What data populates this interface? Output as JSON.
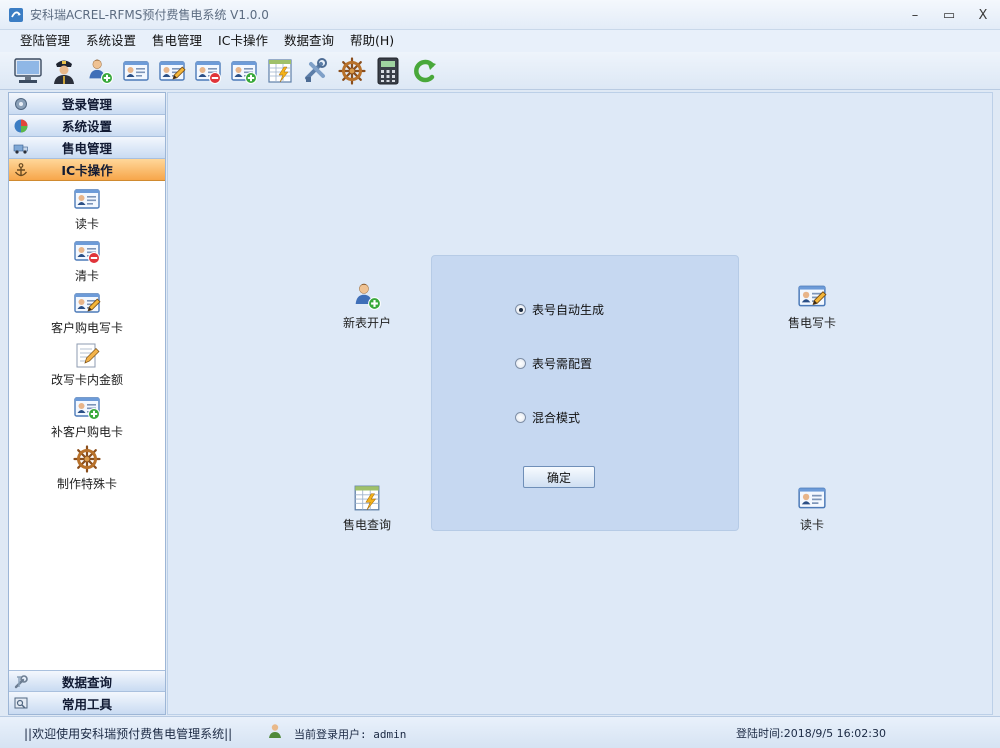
{
  "window": {
    "title": "安科瑞ACREL-RFMS预付费售电系统 V1.0.0",
    "minimize": "–",
    "maximize": "▭",
    "close": "X"
  },
  "menu": [
    "登陆管理",
    "系统设置",
    "售电管理",
    "IC卡操作",
    "数据查询",
    "帮助(H)"
  ],
  "toolbar_icons": [
    "monitor-icon",
    "officer-icon",
    "add-user-icon",
    "id-card-icon",
    "card-edit-icon",
    "card-remove-icon",
    "card-add-icon",
    "table-lightning-icon",
    "tools-icon",
    "helm-wheel-icon",
    "calculator-icon",
    "refresh-arrow-icon"
  ],
  "sidebar": {
    "categories": [
      {
        "label": "登录管理",
        "icon": "gear-icon"
      },
      {
        "label": "系统设置",
        "icon": "chart-pie-icon"
      },
      {
        "label": "售电管理",
        "icon": "truck-icon"
      },
      {
        "label": "IC卡操作",
        "icon": "anchor-icon",
        "active": true
      }
    ],
    "items": [
      {
        "label": "读卡",
        "icon": "id-card-icon"
      },
      {
        "label": "清卡",
        "icon": "card-remove-icon"
      },
      {
        "label": "客户购电写卡",
        "icon": "card-edit-icon"
      },
      {
        "label": "改写卡内金额",
        "icon": "pencil-note-icon"
      },
      {
        "label": "补客户购电卡",
        "icon": "card-add-icon"
      },
      {
        "label": "制作特殊卡",
        "icon": "helm-wheel-icon"
      }
    ],
    "bottom_categories": [
      {
        "label": "数据查询",
        "icon": "wrench-icon"
      },
      {
        "label": "常用工具",
        "icon": "toolbox-icon"
      }
    ]
  },
  "main": {
    "actions": {
      "new_meter": "新表开户",
      "sell_write": "售电写卡",
      "sell_query": "售电查询",
      "read_card": "读卡"
    },
    "dialog": {
      "options": [
        {
          "label": "表号自动生成",
          "checked": true
        },
        {
          "label": "表号需配置",
          "checked": false
        },
        {
          "label": "混合模式",
          "checked": false
        }
      ],
      "confirm": "确定"
    }
  },
  "status": {
    "welcome": "||欢迎使用安科瑞预付费售电管理系统||",
    "user": "当前登录用户: admin",
    "login_time": "登陆时间:2018/9/5 16:02:30"
  },
  "colors": {
    "active_category": "#f7a64a",
    "panel_bg": "#dee9f7",
    "dialog_bg": "#c6d8f1"
  }
}
